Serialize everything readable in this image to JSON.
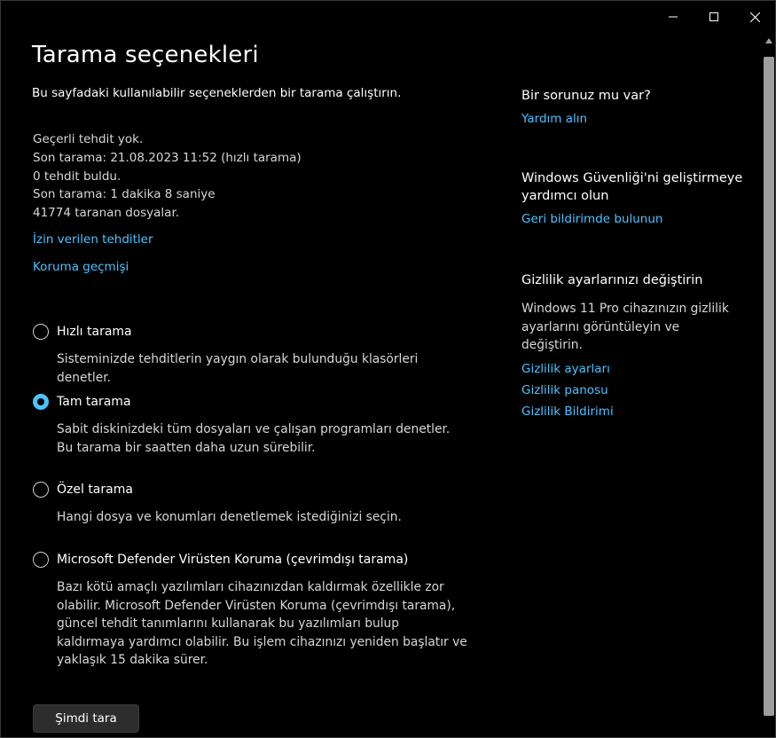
{
  "window": {
    "controls": {
      "minimize_icon": "minimize-icon",
      "maximize_icon": "maximize-icon",
      "close_icon": "close-icon"
    }
  },
  "page": {
    "title": "Tarama seçenekleri",
    "subtitle": "Bu sayfadaki kullanılabilir seçeneklerden bir tarama çalıştırın."
  },
  "status": {
    "lines": [
      "Geçerli tehdit yok.",
      "Son tarama: 21.08.2023 11:52 (hızlı tarama)",
      "0 tehdit buldu.",
      "Son tarama: 1 dakika 8 saniye",
      "41774 taranan dosyalar."
    ]
  },
  "links": {
    "allowed_threats": "İzin verilen tehditler",
    "protection_history": "Koruma geçmişi"
  },
  "scan_options": [
    {
      "label": "Hızlı tarama",
      "description": "Sisteminizde tehditlerin yaygın olarak bulunduğu klasörleri denetler.",
      "selected": false
    },
    {
      "label": "Tam tarama",
      "description": "Sabit diskinizdeki tüm dosyaları ve çalışan programları denetler. Bu tarama bir saatten daha uzun sürebilir.",
      "selected": true
    },
    {
      "label": "Özel tarama",
      "description": "Hangi dosya ve konumları denetlemek istediğinizi seçin.",
      "selected": false
    },
    {
      "label": "Microsoft Defender Virüsten Koruma (çevrimdışı tarama)",
      "description": "Bazı kötü amaçlı yazılımları cihazınızdan kaldırmak özellikle zor olabilir. Microsoft Defender Virüsten Koruma (çevrimdışı tarama), güncel tehdit tanımlarını kullanarak bu yazılımları bulup kaldırmaya yardımcı olabilir. Bu işlem cihazınızı yeniden başlatır ve yaklaşık 15 dakika sürer.",
      "selected": false
    }
  ],
  "scan_button": {
    "label": "Şimdi tara"
  },
  "sidebar": {
    "question": {
      "heading": "Bir sorunuz mu var?",
      "link": "Yardım alın"
    },
    "improve": {
      "heading": "Windows Güvenliği'ni geliştirmeye yardımcı olun",
      "link": "Geri bildirimde bulunun"
    },
    "privacy": {
      "heading": "Gizlilik ayarlarınızı değiştirin",
      "text": "Windows 11 Pro cihazınızın gizlilik ayarlarını görüntüleyin ve değiştirin.",
      "links": [
        "Gizlilik ayarları",
        "Gizlilik panosu",
        "Gizlilik Bildirimi"
      ]
    }
  },
  "colors": {
    "background": "#000000",
    "accent": "#4cc2ff",
    "text": "#ffffff",
    "secondary_text": "#d6d6d6",
    "button_bg": "#2d2d2d"
  }
}
